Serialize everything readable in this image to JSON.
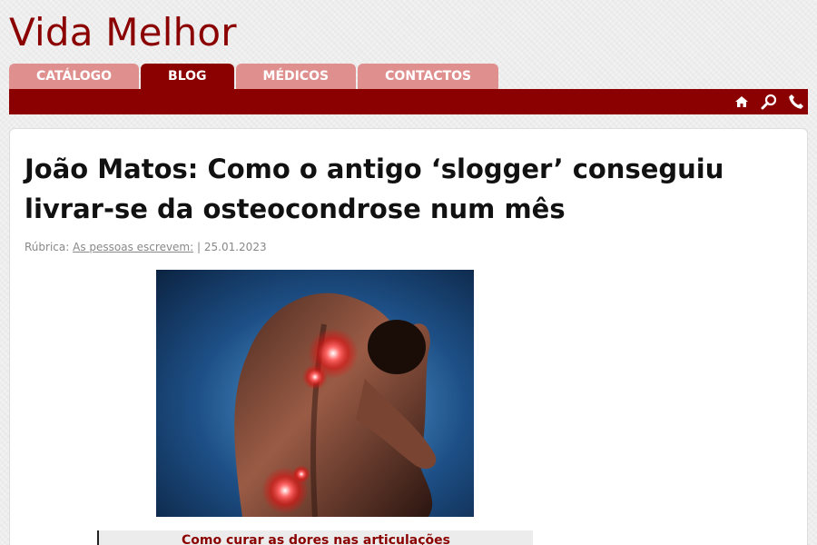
{
  "site": {
    "title": "Vida Melhor"
  },
  "nav": {
    "tabs": [
      {
        "label": "CATÁLOGO"
      },
      {
        "label": "BLOG"
      },
      {
        "label": "MÉDICOS"
      },
      {
        "label": "CONTACTOS"
      }
    ],
    "active_tab": "BLOG",
    "icons": [
      "home-icon",
      "search-icon",
      "phone-icon"
    ]
  },
  "article": {
    "title": "João Matos: Como o antigo ‘slogger’ conseguiu livrar-se da osteocondrose num mês",
    "meta": {
      "rubric_label": "Rúbrica:",
      "rubric_link": "As pessoas escrevem:",
      "separator": "|",
      "date": "25.01.2023"
    },
    "callout_title": "Como curar as dores nas articulações"
  },
  "colors": {
    "brand": "#8b0000",
    "tab_inactive": "#e08f8f",
    "text": "#111111",
    "meta": "#888888"
  }
}
